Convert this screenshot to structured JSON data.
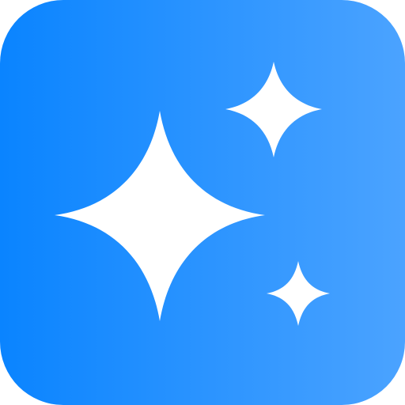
{
  "icon": {
    "name": "sparkles-app-icon",
    "gradient_start": "#0A84FF",
    "gradient_end": "#4BA3FF",
    "glyph_color": "#FFFFFF",
    "glyph": "sparkles-icon"
  }
}
